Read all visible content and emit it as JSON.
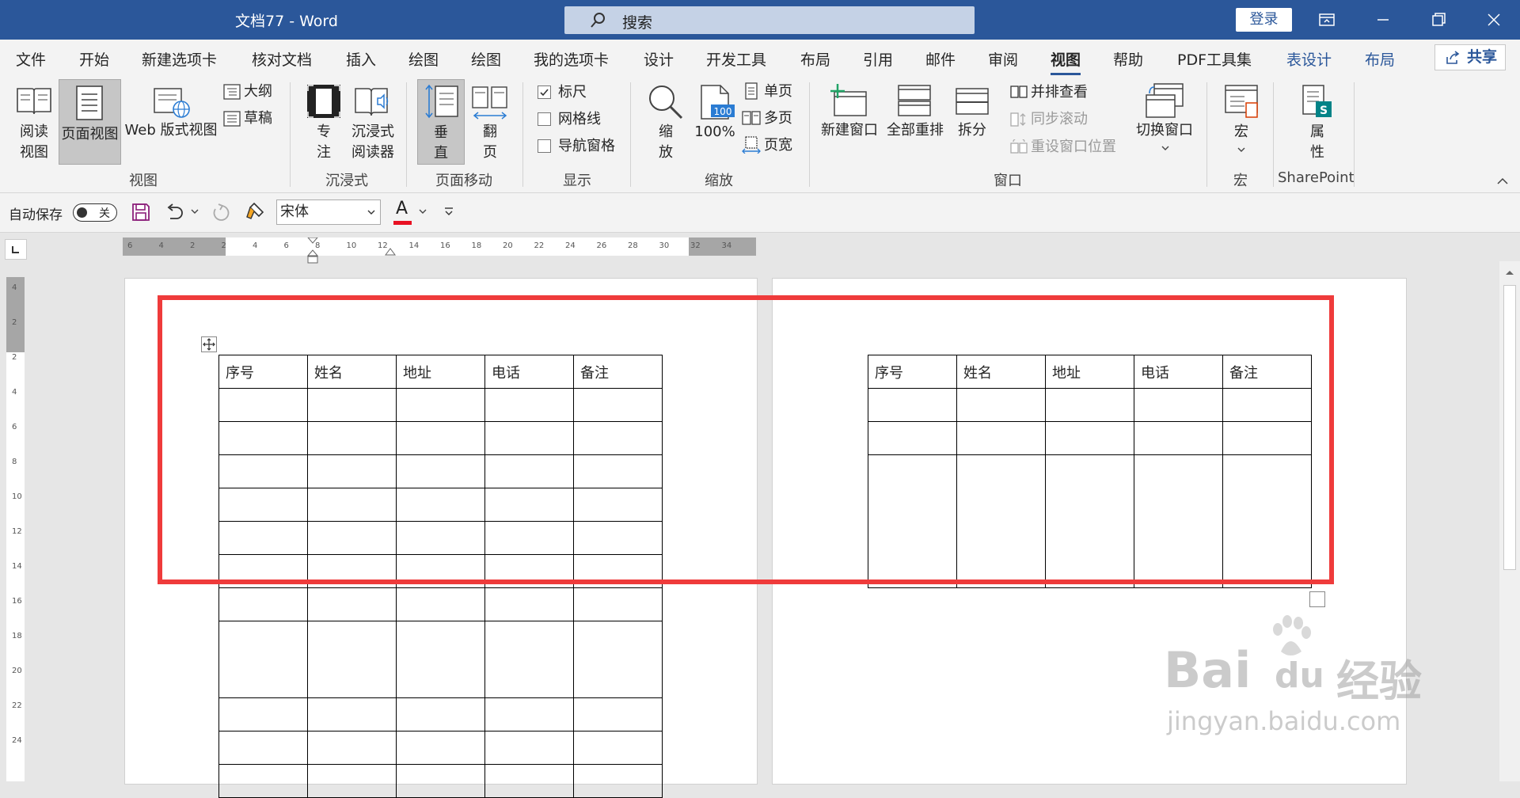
{
  "title_bar": {
    "doc_title": "文档77  -  Word",
    "search_label": "搜索",
    "login_label": "登录"
  },
  "menu_tabs": [
    {
      "label": "文件"
    },
    {
      "label": "开始"
    },
    {
      "label": "新建选项卡"
    },
    {
      "label": "核对文档"
    },
    {
      "label": "插入"
    },
    {
      "label": "绘图"
    },
    {
      "label": "绘图"
    },
    {
      "label": "我的选项卡"
    },
    {
      "label": "设计"
    },
    {
      "label": "开发工具"
    },
    {
      "label": "布局"
    },
    {
      "label": "引用"
    },
    {
      "label": "邮件"
    },
    {
      "label": "审阅"
    },
    {
      "label": "视图"
    },
    {
      "label": "帮助"
    },
    {
      "label": "PDF工具集"
    },
    {
      "label": "表设计"
    },
    {
      "label": "布局"
    }
  ],
  "share_label": "共享",
  "ribbon": {
    "views": {
      "read_mode": "阅读\n视图",
      "print_layout": "页面视图",
      "web_layout": "Web 版式视图",
      "outline": "大纲",
      "draft": "草稿",
      "group": "视图"
    },
    "immersive": {
      "focus": "专\n注",
      "reader": "沉浸式\n阅读器",
      "group": "沉浸式"
    },
    "page_move": {
      "vertical": "垂\n直",
      "side": "翻\n页",
      "group": "页面移动"
    },
    "show": {
      "ruler": "标尺",
      "gridlines": "网格线",
      "nav_pane": "导航窗格",
      "group": "显示"
    },
    "zoom": {
      "zoom": "缩\n放",
      "pct": "100%",
      "pct_icon": "100",
      "one_page": "单页",
      "multi_page": "多页",
      "page_width": "页宽",
      "group": "缩放"
    },
    "window": {
      "new_window": "新建窗口",
      "arrange_all": "全部重排",
      "split": "拆分",
      "side_by_side": "并排查看",
      "sync_scroll": "同步滚动",
      "reset_pos": "重设窗口位置",
      "switch": "切换窗口",
      "group": "窗口"
    },
    "macros": {
      "label": "宏",
      "group": "宏"
    },
    "sharepoint": {
      "label": "属\n性",
      "group": "SharePoint"
    }
  },
  "qat": {
    "autosave": "自动保存",
    "autosave_state": "关",
    "font": "宋体"
  },
  "ruler_h_labels": [
    "6",
    "4",
    "2",
    "2",
    "4",
    "6",
    "8",
    "10",
    "12",
    "14",
    "16",
    "18",
    "20",
    "22",
    "24",
    "26",
    "28",
    "30",
    "32",
    "34"
  ],
  "ruler_v_labels": [
    "4",
    "2",
    "2",
    "4",
    "6",
    "8",
    "10",
    "12",
    "14",
    "16",
    "18",
    "20",
    "22",
    "24"
  ],
  "table": {
    "headers": [
      "序号",
      "姓名",
      "地址",
      "电话",
      "备注"
    ]
  },
  "watermark": {
    "brand": "Bai",
    "brand2": "du",
    "cn": "经验",
    "url": "jingyan.baidu.com"
  }
}
